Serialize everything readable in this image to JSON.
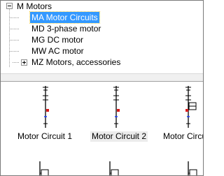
{
  "tree": {
    "root": {
      "label": "M Motors",
      "expanded": true
    },
    "children": [
      {
        "label": "MA Motor Circuits",
        "selected": true,
        "expandable": false
      },
      {
        "label": "MD 3-phase motor",
        "selected": false,
        "expandable": false
      },
      {
        "label": "MG DC motor",
        "selected": false,
        "expandable": false
      },
      {
        "label": "MW AC motor",
        "selected": false,
        "expandable": false
      },
      {
        "label": "MZ Motors, accessories",
        "selected": false,
        "expandable": true
      }
    ]
  },
  "thumbnails": [
    {
      "label": "Motor Circuit 1",
      "variant": "simple"
    },
    {
      "label": "Motor Circuit 2",
      "variant": "simple",
      "hover": true
    },
    {
      "label": "Motor Circui",
      "variant": "box"
    }
  ],
  "thumbnails_row2": [
    {
      "variant": "stub-box"
    },
    {
      "variant": "stub-box"
    },
    {
      "variant": "stub-box"
    }
  ],
  "colors": {
    "selection": "#3399ff",
    "accent_red": "#d81b1b",
    "accent_blue": "#1a3cff"
  }
}
